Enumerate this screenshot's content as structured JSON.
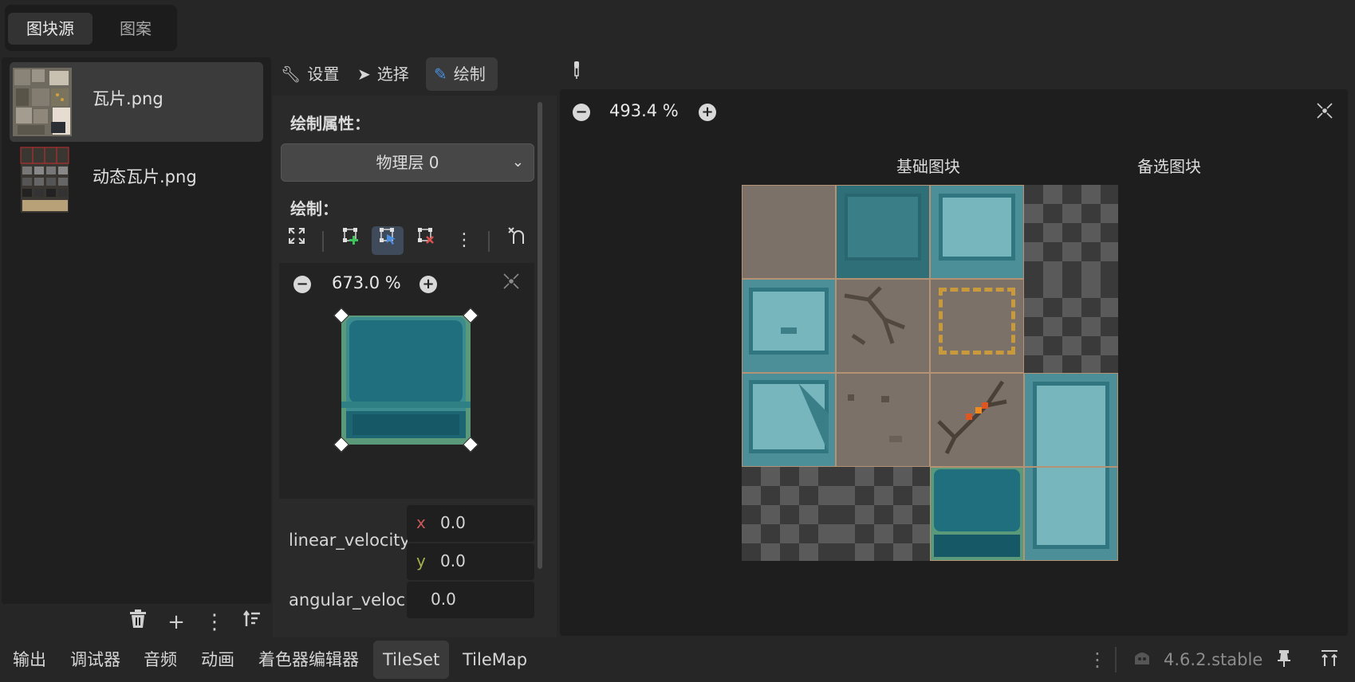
{
  "top_tabs": [
    {
      "label": "图块源",
      "active": true
    },
    {
      "label": "图案",
      "active": false
    }
  ],
  "sources": [
    {
      "label": "瓦片.png",
      "selected": true
    },
    {
      "label": "动态瓦片.png",
      "selected": false
    }
  ],
  "source_toolbar": {
    "delete_icon": "trash-icon",
    "add_icon": "plus-icon",
    "more_icon": "kebab-icon",
    "sort_icon": "sort-icon"
  },
  "mode_tabs": [
    {
      "label": "设置",
      "icon": "wrench-icon",
      "active": false
    },
    {
      "label": "选择",
      "icon": "cursor-icon",
      "active": false
    },
    {
      "label": "绘制",
      "icon": "brush-icon",
      "active": true
    }
  ],
  "paint_panel": {
    "properties_title": "绘制属性：",
    "layer_dropdown": "物理层 0",
    "paint_title": "绘制：",
    "zoom": "673.0 %",
    "linear_velocity_label": "linear_velocity",
    "linear_velocity": {
      "x": "0.0",
      "y": "0.0"
    },
    "angular_velocity_label": "angular_veloc",
    "angular_velocity": "0.0"
  },
  "atlas": {
    "zoom": "493.4 %",
    "base_tiles_label": "基础图块",
    "alt_tiles_label": "备选图块"
  },
  "bottom_tabs": [
    {
      "label": "输出",
      "active": false
    },
    {
      "label": "调试器",
      "active": false
    },
    {
      "label": "音频",
      "active": false
    },
    {
      "label": "动画",
      "active": false
    },
    {
      "label": "着色器编辑器",
      "active": false
    },
    {
      "label": "TileSet",
      "active": true
    },
    {
      "label": "TileMap",
      "active": false
    }
  ],
  "version": "4.6.2.stable",
  "colors": {
    "accent": "#4a90e2",
    "tile_teal": "#2f6f78",
    "tile_light": "#5ea2aa",
    "tile_dirt": "#7b7168",
    "selection_border": "#b49274"
  }
}
